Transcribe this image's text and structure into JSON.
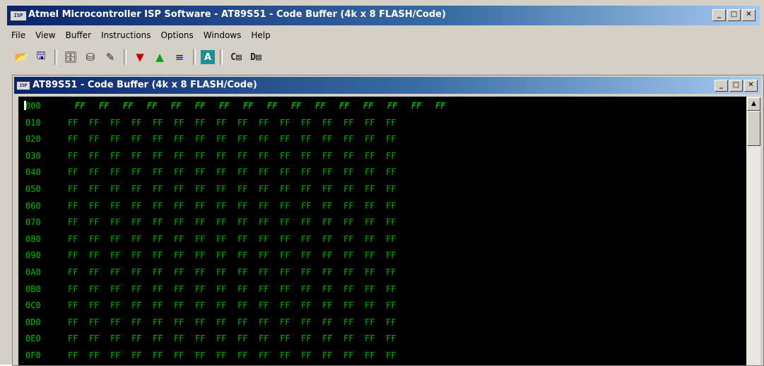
{
  "app": {
    "title": "Atmel Microcontroller ISP Software - AT89S51 - Code Buffer  (4k x 8 FLASH/Code)",
    "icon_text": "ISP",
    "window_controls": {
      "minimize": "_",
      "maximize": "□",
      "close": "✕"
    }
  },
  "menu": [
    "File",
    "View",
    "Buffer",
    "Instructions",
    "Options",
    "Windows",
    "Help"
  ],
  "toolbar": {
    "buttons": [
      {
        "icon": "open-folder-icon",
        "glyph": "📂"
      },
      {
        "icon": "save-disk-icon",
        "glyph": "🖫"
      },
      {
        "icon": "chip-icon",
        "glyph": "🗄"
      },
      {
        "icon": "device-icon",
        "glyph": "⛁"
      },
      {
        "icon": "wand-icon",
        "glyph": "✎"
      },
      {
        "icon": "program-down-icon",
        "glyph": "▼"
      },
      {
        "icon": "program-up-icon",
        "glyph": "▲"
      },
      {
        "icon": "program-icon",
        "glyph": "≡"
      },
      {
        "icon": "auto-icon",
        "glyph": "A"
      },
      {
        "icon": "code-buffer-icon",
        "glyph": "C▤"
      },
      {
        "icon": "data-buffer-icon",
        "glyph": "D▤"
      }
    ]
  },
  "child_window": {
    "title": "AT89S51 - Code Buffer  (4k x 8 FLASH/Code)",
    "icon_text": "ISP"
  },
  "buffer": {
    "text_color": "#00b000",
    "rows": [
      {
        "address": "000",
        "byte": "FF"
      },
      {
        "address": "010",
        "byte": "FF"
      },
      {
        "address": "020",
        "byte": "FF"
      },
      {
        "address": "030",
        "byte": "FF"
      },
      {
        "address": "040",
        "byte": "FF"
      },
      {
        "address": "050",
        "byte": "FF"
      },
      {
        "address": "060",
        "byte": "FF"
      },
      {
        "address": "070",
        "byte": "FF"
      },
      {
        "address": "080",
        "byte": "FF"
      },
      {
        "address": "090",
        "byte": "FF"
      },
      {
        "address": "0A0",
        "byte": "FF"
      },
      {
        "address": "0B0",
        "byte": "FF"
      },
      {
        "address": "0C0",
        "byte": "FF"
      },
      {
        "address": "0D0",
        "byte": "FF"
      },
      {
        "address": "0E0",
        "byte": "FF"
      },
      {
        "address": "0F0",
        "byte": "FF"
      }
    ],
    "bytes_per_row": 16
  }
}
